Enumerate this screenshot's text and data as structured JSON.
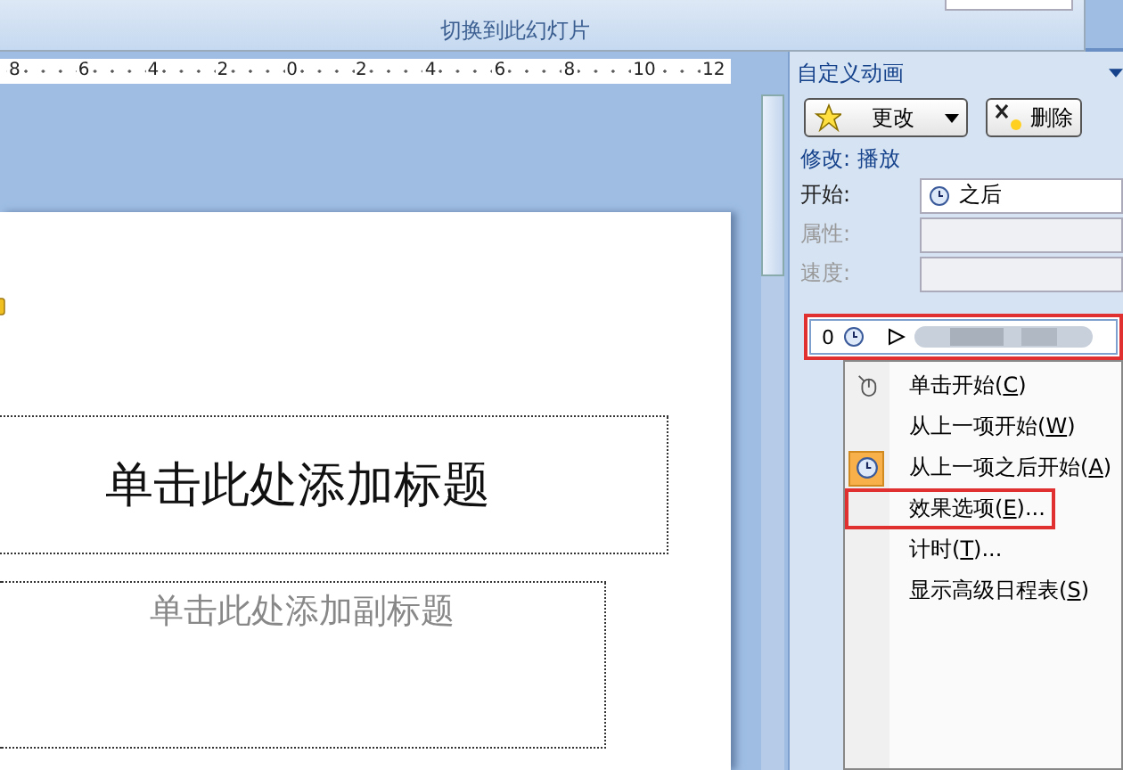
{
  "ribbon": {
    "group_label": "切换到此幻灯片"
  },
  "ruler": {
    "labels": [
      "8",
      "6",
      "4",
      "2",
      "0",
      "2",
      "4",
      "6",
      "8",
      "10",
      "12"
    ]
  },
  "slide": {
    "title_placeholder": "单击此处添加标题",
    "subtitle_placeholder": "单击此处添加副标题"
  },
  "task_pane": {
    "title": "自定义动画",
    "change_button": "更改",
    "remove_button": "删除",
    "modify_label": "修改: 播放",
    "fields": [
      {
        "label": "开始:",
        "value": "之后",
        "disabled": false
      },
      {
        "label": "属性:",
        "disabled": true
      },
      {
        "label": "速度:",
        "disabled": true
      }
    ],
    "animation_item": {
      "order": "0",
      "highlighted": true
    },
    "context_menu": [
      {
        "parts": [
          "单击开始(",
          "C",
          ")"
        ],
        "kind": "mouse",
        "checked": false,
        "highlighted": false
      },
      {
        "parts": [
          "从上一项开始(",
          "W",
          ")"
        ],
        "checked": false,
        "highlighted": false
      },
      {
        "parts": [
          "从上一项之后开始(",
          "A",
          ")"
        ],
        "kind": "clock",
        "checked": true,
        "highlighted": false
      },
      {
        "parts": [
          "效果选项(",
          "E",
          ")..."
        ],
        "checked": false,
        "highlighted": true
      },
      {
        "parts": [
          "计时(",
          "T",
          ")..."
        ],
        "checked": false,
        "highlighted": false
      },
      {
        "parts": [
          "显示高级日程表(",
          "S",
          ")"
        ],
        "checked": false,
        "highlighted": false
      }
    ]
  }
}
